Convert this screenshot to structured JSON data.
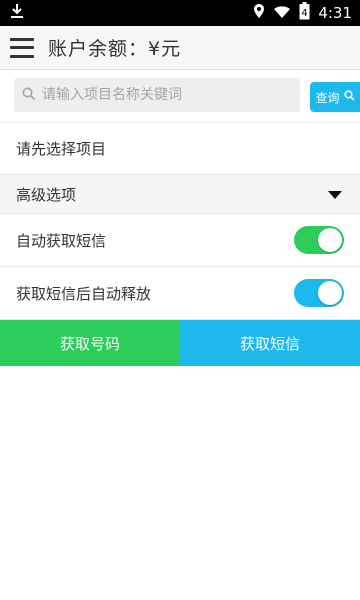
{
  "status_bar": {
    "time": "4:31",
    "battery_level": "4"
  },
  "app_bar": {
    "title": "账户余额：¥元"
  },
  "search": {
    "placeholder": "请输入项目名称关键词",
    "button_label": "查询"
  },
  "project": {
    "placeholder_text": "请先选择项目"
  },
  "advanced": {
    "label": "高级选项"
  },
  "options": [
    {
      "label": "自动获取短信",
      "enabled": true,
      "color": "#2dcd5c"
    },
    {
      "label": "获取短信后自动释放",
      "enabled": true,
      "color": "#1eb9ec"
    }
  ],
  "actions": {
    "get_number": {
      "label": "获取号码",
      "color": "#2dcd5c"
    },
    "get_sms": {
      "label": "获取短信",
      "color": "#1eb9ec"
    }
  }
}
